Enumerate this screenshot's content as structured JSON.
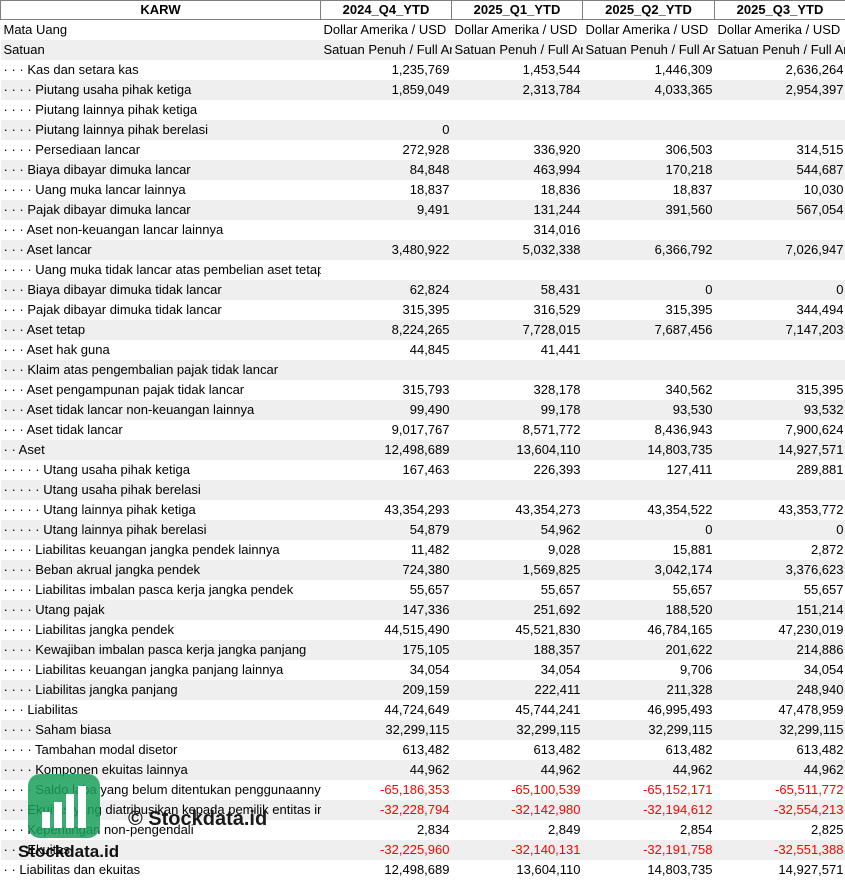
{
  "header": [
    "KARW",
    "2024_Q4_YTD",
    "2025_Q1_YTD",
    "2025_Q2_YTD",
    "2025_Q3_YTD"
  ],
  "meta_rows": [
    {
      "label": "Mata Uang",
      "values": [
        "Dollar Amerika / USD",
        "Dollar Amerika / USD",
        "Dollar Amerika / USD",
        "Dollar Amerika / USD"
      ]
    },
    {
      "label": "Satuan",
      "values": [
        "Satuan Penuh / Full Amount",
        "Satuan Penuh / Full Amount",
        "Satuan Penuh / Full Amount",
        "Satuan Penuh / Full Amount"
      ]
    }
  ],
  "rows": [
    {
      "label": "· · · Kas dan setara kas",
      "values": [
        "1,235,769",
        "1,453,544",
        "1,446,309",
        "2,636,264"
      ]
    },
    {
      "label": "· · · · Piutang usaha pihak ketiga",
      "values": [
        "1,859,049",
        "2,313,784",
        "4,033,365",
        "2,954,397"
      ]
    },
    {
      "label": "· · · · Piutang lainnya pihak ketiga",
      "values": [
        "",
        "",
        "",
        ""
      ]
    },
    {
      "label": "· · · · Piutang lainnya pihak berelasi",
      "values": [
        "0",
        "",
        "",
        ""
      ]
    },
    {
      "label": "· · · · Persediaan lancar",
      "values": [
        "272,928",
        "336,920",
        "306,503",
        "314,515"
      ]
    },
    {
      "label": "· · · Biaya dibayar dimuka lancar",
      "values": [
        "84,848",
        "463,994",
        "170,218",
        "544,687"
      ]
    },
    {
      "label": "· · · · Uang muka lancar lainnya",
      "values": [
        "18,837",
        "18,836",
        "18,837",
        "10,030"
      ]
    },
    {
      "label": "· · · Pajak dibayar dimuka lancar",
      "values": [
        "9,491",
        "131,244",
        "391,560",
        "567,054"
      ]
    },
    {
      "label": "· · · Aset non-keuangan lancar lainnya",
      "values": [
        "",
        "314,016",
        "",
        ""
      ]
    },
    {
      "label": "· · · Aset lancar",
      "values": [
        "3,480,922",
        "5,032,338",
        "6,366,792",
        "7,026,947"
      ]
    },
    {
      "label": "· · · · Uang muka tidak lancar atas pembelian aset tetap",
      "values": [
        "",
        "",
        "",
        ""
      ]
    },
    {
      "label": "· · · Biaya dibayar dimuka tidak lancar",
      "values": [
        "62,824",
        "58,431",
        "0",
        "0"
      ]
    },
    {
      "label": "· · · Pajak dibayar dimuka tidak lancar",
      "values": [
        "315,395",
        "316,529",
        "315,395",
        "344,494"
      ]
    },
    {
      "label": "· · · Aset tetap",
      "values": [
        "8,224,265",
        "7,728,015",
        "7,687,456",
        "7,147,203"
      ]
    },
    {
      "label": "· · · Aset hak guna",
      "values": [
        "44,845",
        "41,441",
        "",
        ""
      ]
    },
    {
      "label": "· · · Klaim atas pengembalian pajak tidak lancar",
      "values": [
        "",
        "",
        "",
        ""
      ]
    },
    {
      "label": "· · · Aset pengampunan pajak tidak lancar",
      "values": [
        "315,793",
        "328,178",
        "340,562",
        "315,395"
      ]
    },
    {
      "label": "· · · Aset tidak lancar non-keuangan lainnya",
      "values": [
        "99,490",
        "99,178",
        "93,530",
        "93,532"
      ]
    },
    {
      "label": "· · · Aset tidak lancar",
      "values": [
        "9,017,767",
        "8,571,772",
        "8,436,943",
        "7,900,624"
      ]
    },
    {
      "label": "· · Aset",
      "values": [
        "12,498,689",
        "13,604,110",
        "14,803,735",
        "14,927,571"
      ]
    },
    {
      "label": "· · · · · Utang usaha pihak ketiga",
      "values": [
        "167,463",
        "226,393",
        "127,411",
        "289,881"
      ]
    },
    {
      "label": "· · · · · Utang usaha pihak berelasi",
      "values": [
        "",
        "",
        "",
        ""
      ]
    },
    {
      "label": "· · · · · Utang lainnya pihak ketiga",
      "values": [
        "43,354,293",
        "43,354,273",
        "43,354,522",
        "43,353,772"
      ]
    },
    {
      "label": "· · · · · Utang lainnya pihak berelasi",
      "values": [
        "54,879",
        "54,962",
        "0",
        "0"
      ]
    },
    {
      "label": "· · · · Liabilitas keuangan jangka pendek lainnya",
      "values": [
        "11,482",
        "9,028",
        "15,881",
        "2,872"
      ]
    },
    {
      "label": "· · · · Beban akrual jangka pendek",
      "values": [
        "724,380",
        "1,569,825",
        "3,042,174",
        "3,376,623"
      ]
    },
    {
      "label": "· · · · Liabilitas imbalan pasca kerja jangka pendek",
      "values": [
        "55,657",
        "55,657",
        "55,657",
        "55,657"
      ]
    },
    {
      "label": "· · · · Utang pajak",
      "values": [
        "147,336",
        "251,692",
        "188,520",
        "151,214"
      ]
    },
    {
      "label": "· · · · Liabilitas jangka pendek",
      "values": [
        "44,515,490",
        "45,521,830",
        "46,784,165",
        "47,230,019"
      ]
    },
    {
      "label": "· · · · Kewajiban imbalan pasca kerja jangka panjang",
      "values": [
        "175,105",
        "188,357",
        "201,622",
        "214,886"
      ]
    },
    {
      "label": "· · · · Liabilitas keuangan jangka panjang lainnya",
      "values": [
        "34,054",
        "34,054",
        "9,706",
        "34,054"
      ]
    },
    {
      "label": "· · · · Liabilitas jangka panjang",
      "values": [
        "209,159",
        "222,411",
        "211,328",
        "248,940"
      ]
    },
    {
      "label": "· · · Liabilitas",
      "values": [
        "44,724,649",
        "45,744,241",
        "46,995,493",
        "47,478,959"
      ]
    },
    {
      "label": "· · · · Saham biasa",
      "values": [
        "32,299,115",
        "32,299,115",
        "32,299,115",
        "32,299,115"
      ]
    },
    {
      "label": "· · · · Tambahan modal disetor",
      "values": [
        "613,482",
        "613,482",
        "613,482",
        "613,482"
      ]
    },
    {
      "label": "· · · · Komponen ekuitas lainnya",
      "values": [
        "44,962",
        "44,962",
        "44,962",
        "44,962"
      ]
    },
    {
      "label": "· · · · Saldo laba yang belum ditentukan penggunaannya",
      "values": [
        "-65,186,353",
        "-65,100,539",
        "-65,152,171",
        "-65,511,772"
      ]
    },
    {
      "label": "· · · Ekuitas yang diatribusikan kepada pemilik entitas induk",
      "values": [
        "-32,228,794",
        "-32,142,980",
        "-32,194,612",
        "-32,554,213"
      ]
    },
    {
      "label": "· · · Kepentingan non-pengendali",
      "values": [
        "2,834",
        "2,849",
        "2,854",
        "2,825"
      ]
    },
    {
      "label": "· · · Ekuitas",
      "values": [
        "-32,225,960",
        "-32,140,131",
        "-32,191,758",
        "-32,551,388"
      ]
    },
    {
      "label": "· · Liabilitas dan ekuitas",
      "values": [
        "12,498,689",
        "13,604,110",
        "14,803,735",
        "14,927,571"
      ]
    }
  ],
  "watermark": {
    "text": "© Stockdata.id",
    "brand": "Stockdata.id",
    "icon": "bar-chart-icon",
    "color": "#1aa05a"
  }
}
